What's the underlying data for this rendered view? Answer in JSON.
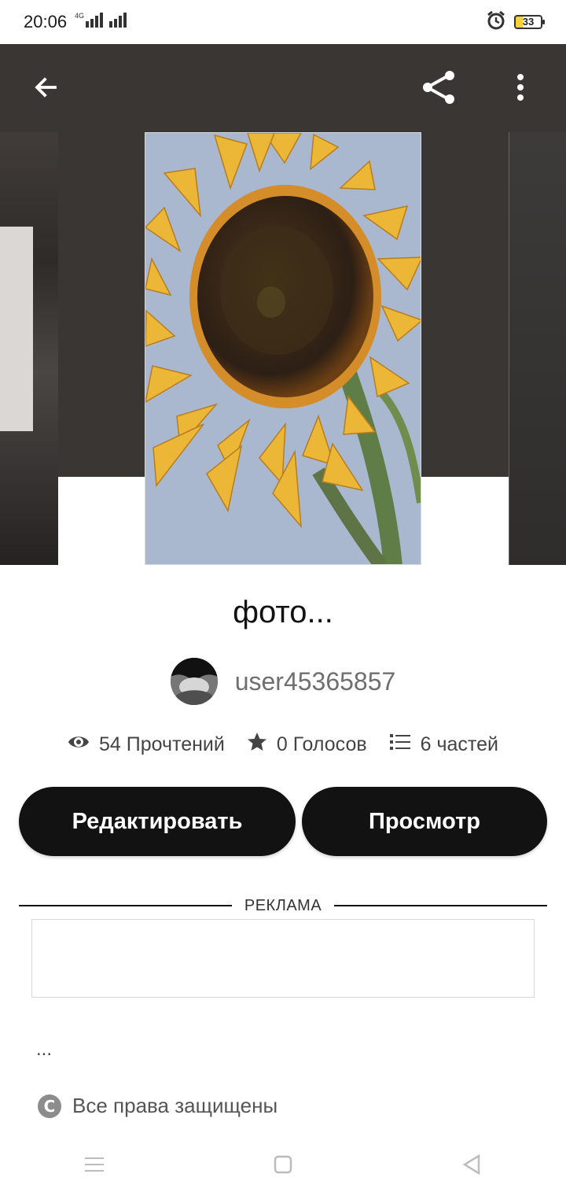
{
  "status_bar": {
    "time": "20:06",
    "network": "4G",
    "battery": "33",
    "icons": [
      "signal-icon",
      "alarm-icon",
      "battery-icon"
    ]
  },
  "topbar": {
    "icons": [
      "back-arrow-icon",
      "share-icon",
      "more-vert-icon"
    ]
  },
  "story": {
    "title": "фото...",
    "author": "user45365857",
    "stats": {
      "reads": "54 Прочтений",
      "votes": "0 Голосов",
      "parts": "6 частей"
    }
  },
  "actions": {
    "edit": "Редактировать",
    "view": "Просмотр"
  },
  "ad": {
    "label": "РЕКЛАМА"
  },
  "description": "...",
  "rights": {
    "text": "Все права защищены",
    "icon": "copyright-icon"
  },
  "colors": {
    "hero_background": "#3a3634",
    "button_background": "#121212",
    "text": "#121212"
  },
  "nav": {
    "icons": [
      "menu-icon",
      "home-icon",
      "back-icon"
    ]
  }
}
